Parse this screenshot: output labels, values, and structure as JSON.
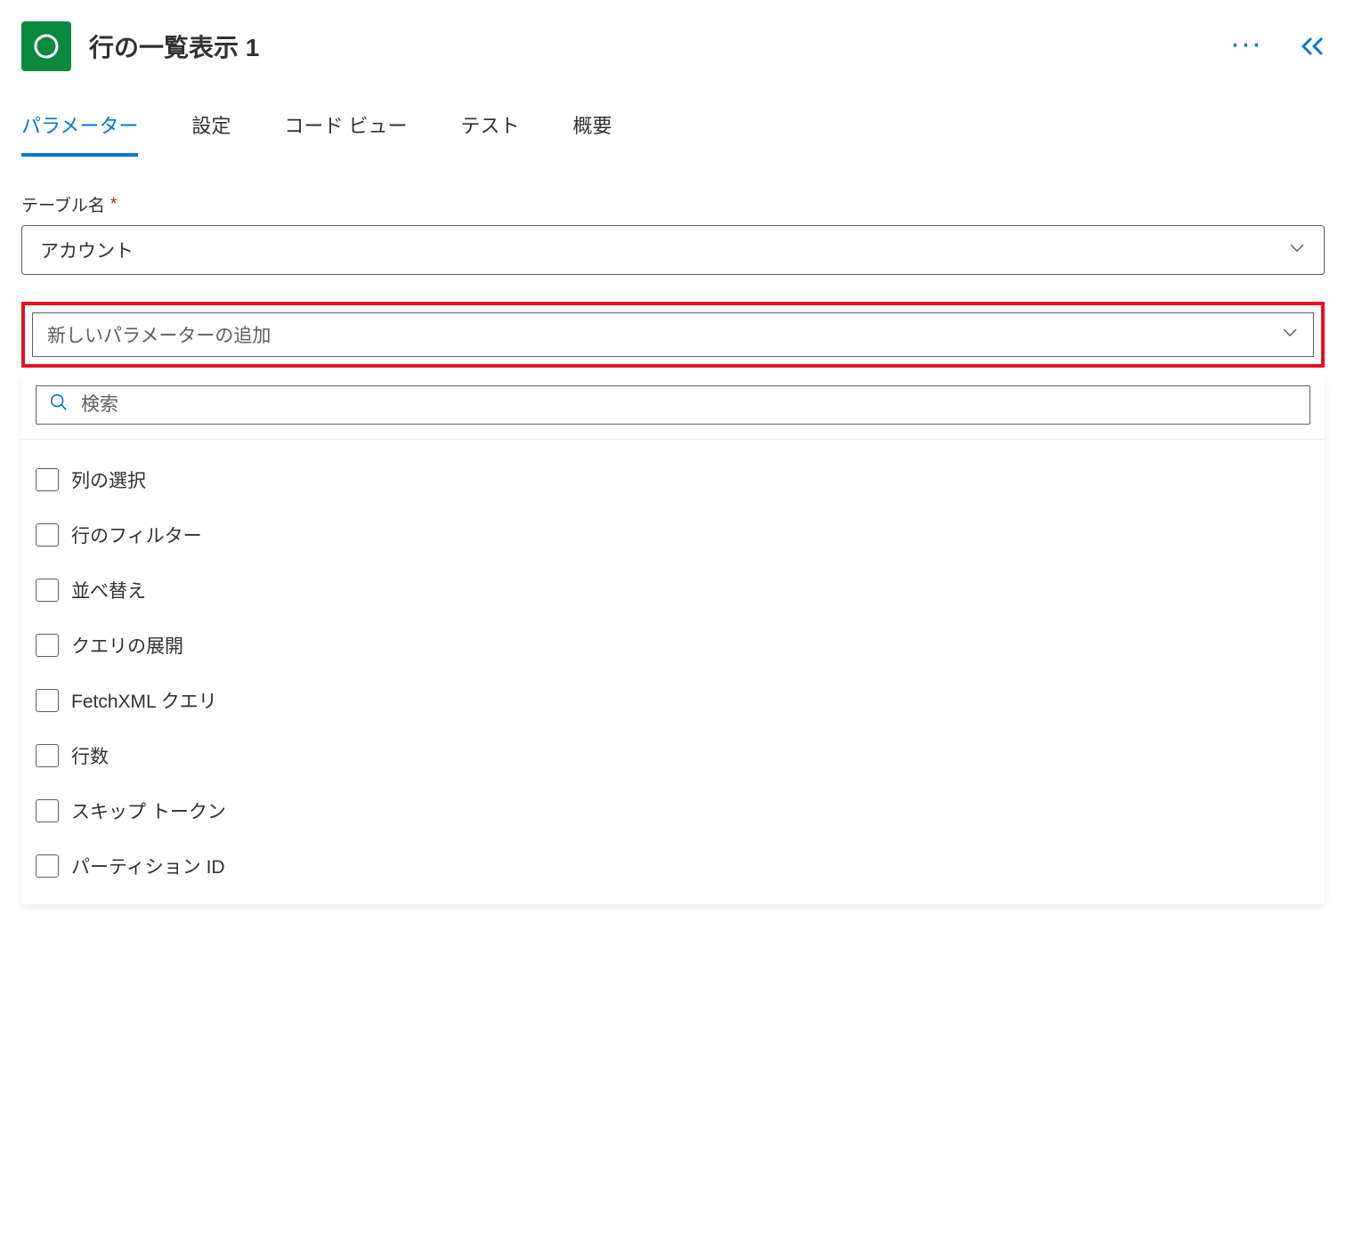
{
  "header": {
    "title": "行の一覧表示 1"
  },
  "tabs": {
    "parameters": "パラメーター",
    "settings": "設定",
    "codeView": "コード ビュー",
    "test": "テスト",
    "about": "概要"
  },
  "fields": {
    "tableName": {
      "label": "テーブル名",
      "value": "アカウント"
    }
  },
  "addParameter": {
    "placeholder": "新しいパラメーターの追加"
  },
  "search": {
    "placeholder": "検索"
  },
  "options": [
    {
      "label": "列の選択"
    },
    {
      "label": "行のフィルター"
    },
    {
      "label": "並べ替え"
    },
    {
      "label": "クエリの展開"
    },
    {
      "label": "FetchXML クエリ"
    },
    {
      "label": "行数"
    },
    {
      "label": "スキップ トークン"
    },
    {
      "label": "パーティション ID"
    }
  ]
}
